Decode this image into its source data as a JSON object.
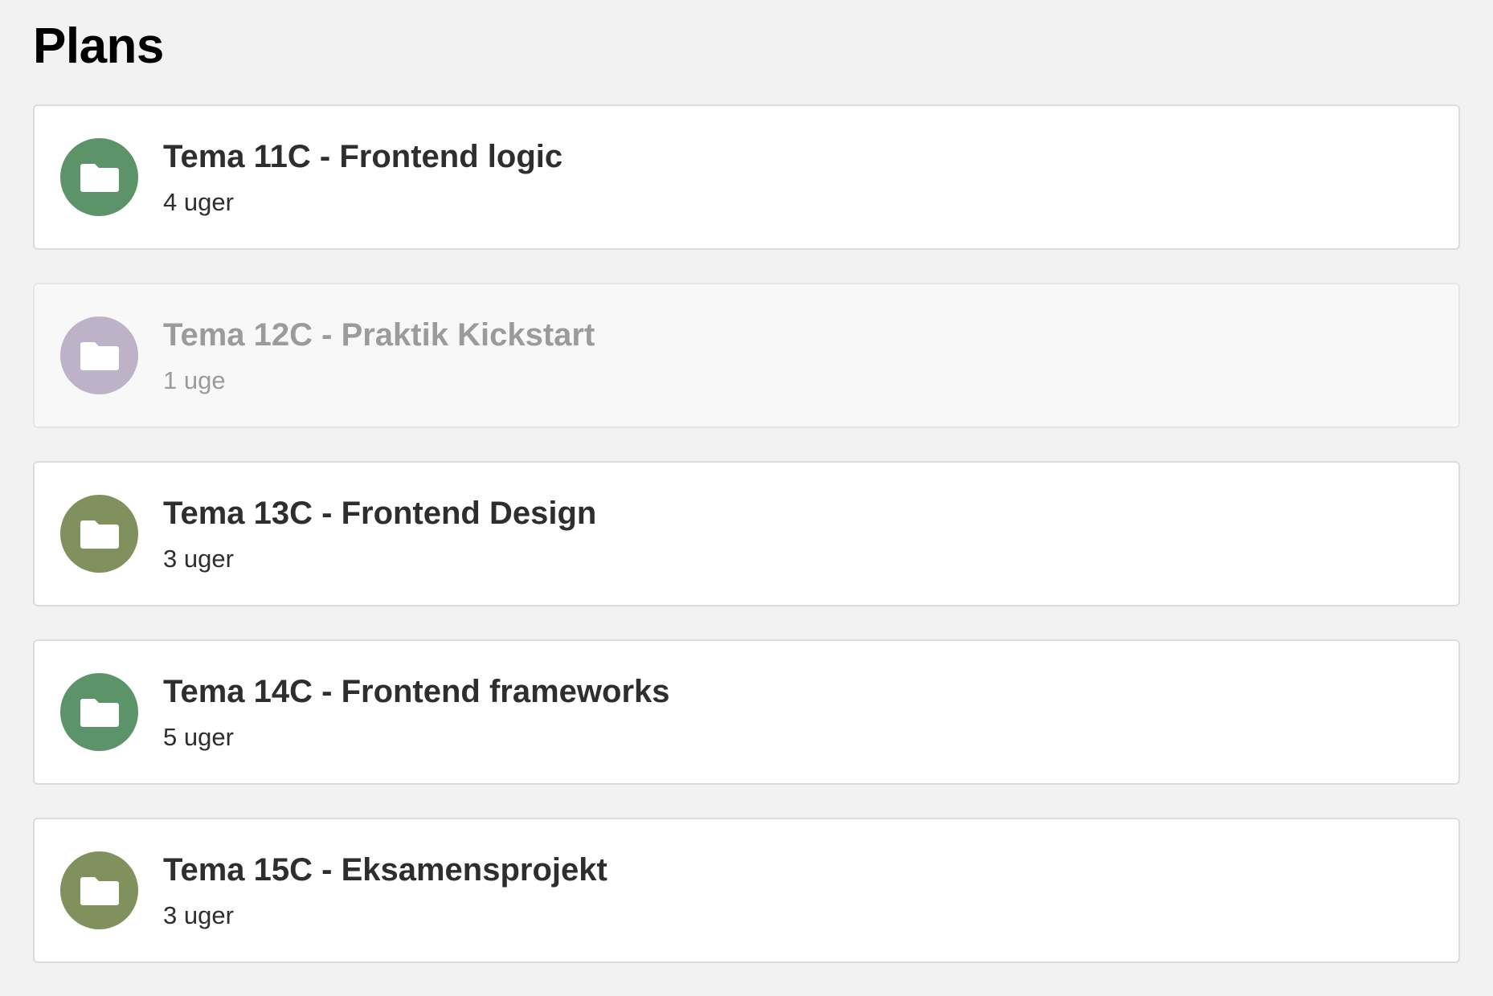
{
  "page": {
    "title": "Plans"
  },
  "plans": [
    {
      "title": "Tema 11C - Frontend logic",
      "duration": "4 uger",
      "icon": "folder-icon",
      "color": "#5c9369",
      "disabled": false
    },
    {
      "title": "Tema 12C - Praktik Kickstart",
      "duration": "1 uge",
      "icon": "folder-icon",
      "color": "#bdb2c8",
      "disabled": true
    },
    {
      "title": "Tema 13C - Frontend Design",
      "duration": "3 uger",
      "icon": "folder-icon",
      "color": "#80915e",
      "disabled": false
    },
    {
      "title": "Tema 14C - Frontend frameworks",
      "duration": "5 uger",
      "icon": "folder-icon",
      "color": "#5c9369",
      "disabled": false
    },
    {
      "title": "Tema 15C - Eksamensprojekt",
      "duration": "3 uger",
      "icon": "folder-icon",
      "color": "#80915e",
      "disabled": false
    }
  ]
}
